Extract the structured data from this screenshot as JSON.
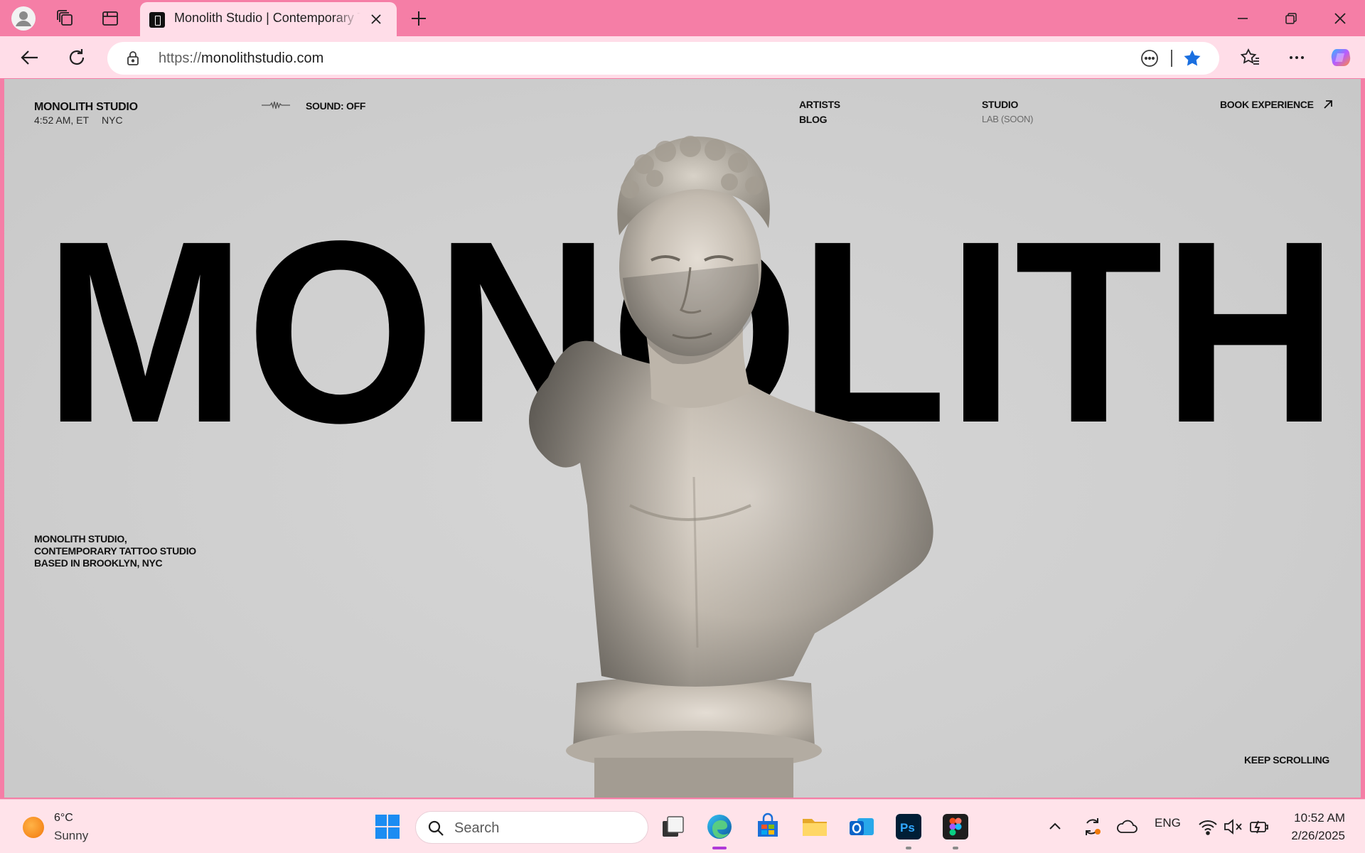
{
  "browser": {
    "tab_title": "Monolith Studio | Contemporary Tattoo Studio",
    "url_scheme": "https://",
    "url_host": "monolithstudio.com",
    "accent": "#f57ea6"
  },
  "site": {
    "brand": "MONOLITH STUDIO",
    "time": "4:52 AM, ET",
    "city": "NYC",
    "sound": "SOUND: OFF",
    "nav": {
      "artists": "ARTISTS",
      "blog": "BLOG",
      "studio": "STUDIO",
      "lab": "LAB (SOON)",
      "book": "BOOK EXPERIENCE"
    },
    "wordmark": "MONOLITH",
    "tagline": [
      "MONOLITH STUDIO,",
      "CONTEMPORARY TATTOO STUDIO",
      "BASED IN BROOKLYN, NYC"
    ],
    "keep_scrolling": "KEEP SCROLLING"
  },
  "taskbar": {
    "temp": "6°C",
    "condition": "Sunny",
    "search_placeholder": "Search",
    "language": "ENG",
    "time": "10:52 AM",
    "date": "2/26/2025"
  }
}
